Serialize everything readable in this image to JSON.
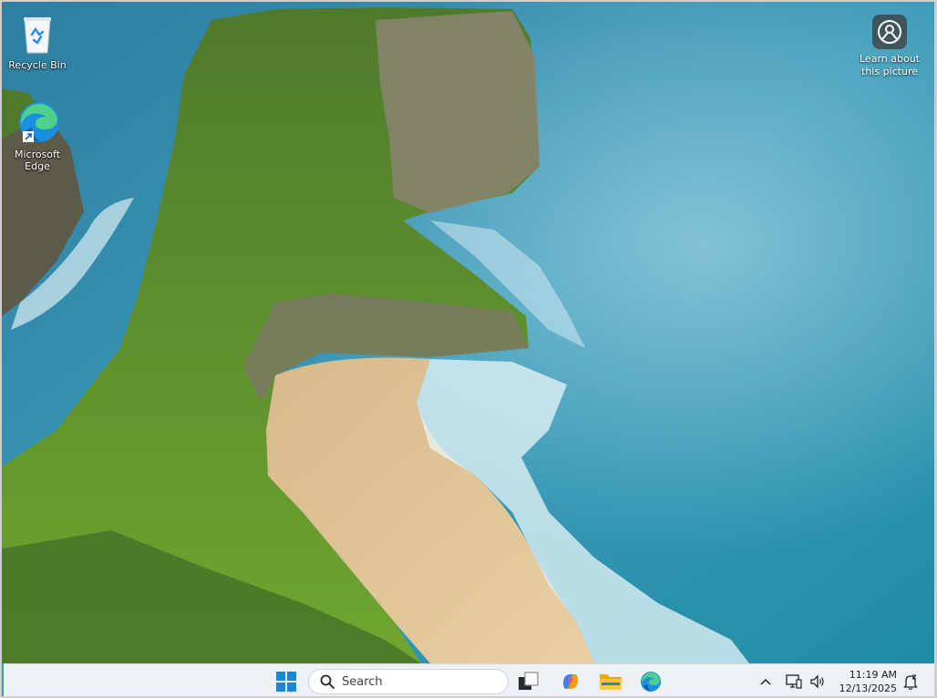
{
  "desktop": {
    "icons": [
      {
        "label": "Recycle Bin",
        "icon": "recycle-bin-icon"
      },
      {
        "label": "Microsoft Edge",
        "label_line1": "Microsoft",
        "label_line2": "Edge",
        "icon": "edge-icon"
      }
    ],
    "learn_about": {
      "line1": "Learn about",
      "line2": "this picture",
      "icon": "camera-lens-icon"
    }
  },
  "taskbar": {
    "search": {
      "placeholder": "Search",
      "icon": "search-icon"
    },
    "pinned": [
      {
        "name": "start",
        "icon": "windows-start-icon"
      },
      {
        "name": "task-view",
        "icon": "task-view-icon"
      },
      {
        "name": "copilot",
        "icon": "copilot-icon"
      },
      {
        "name": "file-explorer",
        "icon": "folder-icon"
      },
      {
        "name": "edge",
        "icon": "edge-icon"
      }
    ],
    "tray": {
      "icons": [
        "chevron-up-icon",
        "network-icon",
        "volume-icon"
      ],
      "time": "11:19 AM",
      "date": "12/13/2025",
      "notification_icon": "notification-bell-icon"
    }
  },
  "colors": {
    "taskbar_bg": "#eef1f6",
    "accent": "#0078d4"
  }
}
